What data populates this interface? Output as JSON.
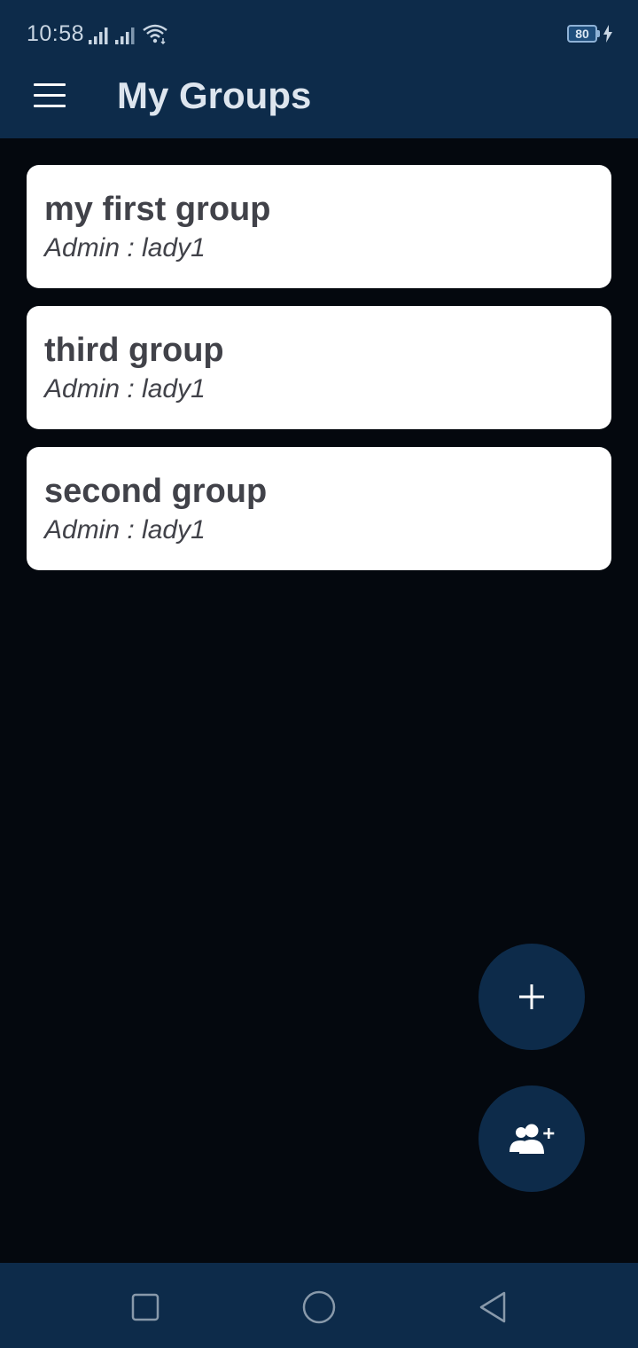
{
  "status_bar": {
    "time": "10:58",
    "battery_level": "80",
    "icons": [
      "signal-icon",
      "signal-icon",
      "wifi-icon",
      "battery-icon",
      "charging-icon"
    ]
  },
  "app_bar": {
    "title": "My Groups",
    "menu_icon": "hamburger-menu-icon"
  },
  "groups": [
    {
      "name": "my first group",
      "admin": "Admin : lady1"
    },
    {
      "name": "third group",
      "admin": "Admin : lady1"
    },
    {
      "name": "second group",
      "admin": "Admin : lady1"
    }
  ],
  "fabs": [
    {
      "icon": "plus-icon"
    },
    {
      "icon": "add-user-icon"
    }
  ],
  "nav_bar": {
    "icons": [
      "recents-square-icon",
      "home-circle-icon",
      "back-triangle-icon"
    ]
  },
  "colors": {
    "primary": "#0d2b4a",
    "background": "#04080e",
    "card": "#ffffff",
    "card_text": "#414249",
    "title_text": "#dde5ee"
  }
}
